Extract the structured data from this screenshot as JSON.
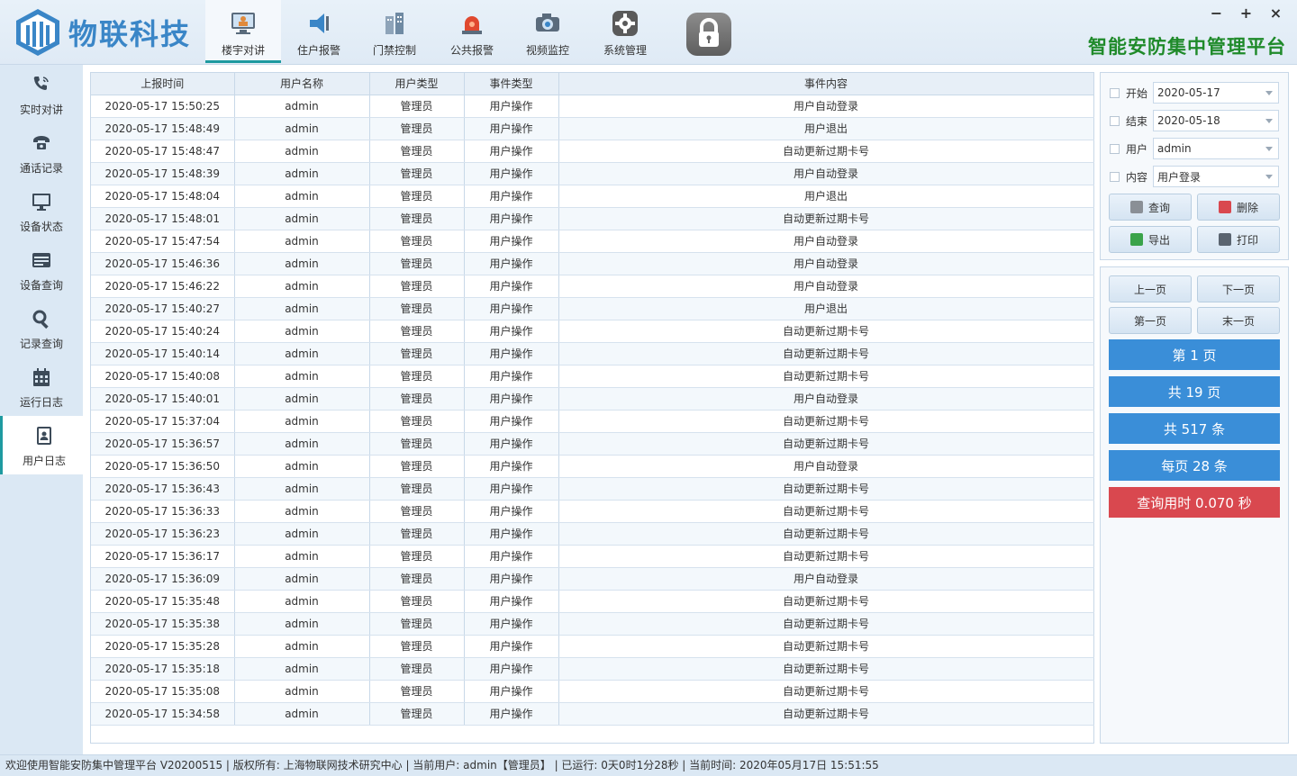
{
  "app": {
    "brand": "物联科技",
    "platform_title": "智能安防集中管理平台",
    "window_controls": [
      "−",
      "+",
      "×"
    ]
  },
  "topnav": [
    {
      "label": "楼宇对讲",
      "icon": "monitor-person-icon",
      "active": true
    },
    {
      "label": "住户报警",
      "icon": "megaphone-icon",
      "active": false
    },
    {
      "label": "门禁控制",
      "icon": "building-icon",
      "active": false
    },
    {
      "label": "公共报警",
      "icon": "siren-icon",
      "active": false
    },
    {
      "label": "视频监控",
      "icon": "camera-icon",
      "active": false
    },
    {
      "label": "系统管理",
      "icon": "gear-icon",
      "active": false
    }
  ],
  "sidebar": [
    {
      "label": "实时对讲",
      "icon": "phone-ring-icon",
      "active": false
    },
    {
      "label": "通话记录",
      "icon": "telephone-icon",
      "active": false
    },
    {
      "label": "设备状态",
      "icon": "desktop-icon",
      "active": false
    },
    {
      "label": "设备查询",
      "icon": "list-card-icon",
      "active": false
    },
    {
      "label": "记录查询",
      "icon": "search-icon",
      "active": false
    },
    {
      "label": "运行日志",
      "icon": "calendar-icon",
      "active": false
    },
    {
      "label": "用户日志",
      "icon": "user-book-icon",
      "active": true
    }
  ],
  "table": {
    "columns": [
      "上报时间",
      "用户名称",
      "用户类型",
      "事件类型",
      "事件内容"
    ],
    "rows": [
      [
        "2020-05-17 15:50:25",
        "admin",
        "管理员",
        "用户操作",
        "用户自动登录"
      ],
      [
        "2020-05-17 15:48:49",
        "admin",
        "管理员",
        "用户操作",
        "用户退出"
      ],
      [
        "2020-05-17 15:48:47",
        "admin",
        "管理员",
        "用户操作",
        "自动更新过期卡号"
      ],
      [
        "2020-05-17 15:48:39",
        "admin",
        "管理员",
        "用户操作",
        "用户自动登录"
      ],
      [
        "2020-05-17 15:48:04",
        "admin",
        "管理员",
        "用户操作",
        "用户退出"
      ],
      [
        "2020-05-17 15:48:01",
        "admin",
        "管理员",
        "用户操作",
        "自动更新过期卡号"
      ],
      [
        "2020-05-17 15:47:54",
        "admin",
        "管理员",
        "用户操作",
        "用户自动登录"
      ],
      [
        "2020-05-17 15:46:36",
        "admin",
        "管理员",
        "用户操作",
        "用户自动登录"
      ],
      [
        "2020-05-17 15:46:22",
        "admin",
        "管理员",
        "用户操作",
        "用户自动登录"
      ],
      [
        "2020-05-17 15:40:27",
        "admin",
        "管理员",
        "用户操作",
        "用户退出"
      ],
      [
        "2020-05-17 15:40:24",
        "admin",
        "管理员",
        "用户操作",
        "自动更新过期卡号"
      ],
      [
        "2020-05-17 15:40:14",
        "admin",
        "管理员",
        "用户操作",
        "自动更新过期卡号"
      ],
      [
        "2020-05-17 15:40:08",
        "admin",
        "管理员",
        "用户操作",
        "自动更新过期卡号"
      ],
      [
        "2020-05-17 15:40:01",
        "admin",
        "管理员",
        "用户操作",
        "用户自动登录"
      ],
      [
        "2020-05-17 15:37:04",
        "admin",
        "管理员",
        "用户操作",
        "自动更新过期卡号"
      ],
      [
        "2020-05-17 15:36:57",
        "admin",
        "管理员",
        "用户操作",
        "自动更新过期卡号"
      ],
      [
        "2020-05-17 15:36:50",
        "admin",
        "管理员",
        "用户操作",
        "用户自动登录"
      ],
      [
        "2020-05-17 15:36:43",
        "admin",
        "管理员",
        "用户操作",
        "自动更新过期卡号"
      ],
      [
        "2020-05-17 15:36:33",
        "admin",
        "管理员",
        "用户操作",
        "自动更新过期卡号"
      ],
      [
        "2020-05-17 15:36:23",
        "admin",
        "管理员",
        "用户操作",
        "自动更新过期卡号"
      ],
      [
        "2020-05-17 15:36:17",
        "admin",
        "管理员",
        "用户操作",
        "自动更新过期卡号"
      ],
      [
        "2020-05-17 15:36:09",
        "admin",
        "管理员",
        "用户操作",
        "用户自动登录"
      ],
      [
        "2020-05-17 15:35:48",
        "admin",
        "管理员",
        "用户操作",
        "自动更新过期卡号"
      ],
      [
        "2020-05-17 15:35:38",
        "admin",
        "管理员",
        "用户操作",
        "自动更新过期卡号"
      ],
      [
        "2020-05-17 15:35:28",
        "admin",
        "管理员",
        "用户操作",
        "自动更新过期卡号"
      ],
      [
        "2020-05-17 15:35:18",
        "admin",
        "管理员",
        "用户操作",
        "自动更新过期卡号"
      ],
      [
        "2020-05-17 15:35:08",
        "admin",
        "管理员",
        "用户操作",
        "自动更新过期卡号"
      ],
      [
        "2020-05-17 15:34:58",
        "admin",
        "管理员",
        "用户操作",
        "自动更新过期卡号"
      ]
    ]
  },
  "filters": [
    {
      "label": "开始",
      "value": "2020-05-17"
    },
    {
      "label": "结束",
      "value": "2020-05-18"
    },
    {
      "label": "用户",
      "value": "admin"
    },
    {
      "label": "内容",
      "value": "用户登录"
    }
  ],
  "actions": {
    "query": "查询",
    "delete": "删除",
    "export": "导出",
    "print": "打印"
  },
  "pager": {
    "prev": "上一页",
    "next": "下一页",
    "first": "第一页",
    "last": "末一页",
    "current_page": "第 1 页",
    "total_pages": "共 19 页",
    "total_records": "共 517 条",
    "per_page": "每页 28 条",
    "query_time": "查询用时 0.070 秒"
  },
  "colors": {
    "accent": "#1e9aa0",
    "info_blue": "#3a8ed8",
    "info_red": "#d9484f",
    "title_green": "#1f8a2a",
    "brand_blue": "#3a86c7"
  },
  "statusbar": "欢迎使用智能安防集中管理平台 V20200515 | 版权所有: 上海物联网技术研究中心 | 当前用户: admin【管理员】 | 已运行: 0天0时1分28秒 | 当前时间: 2020年05月17日 15:51:55"
}
